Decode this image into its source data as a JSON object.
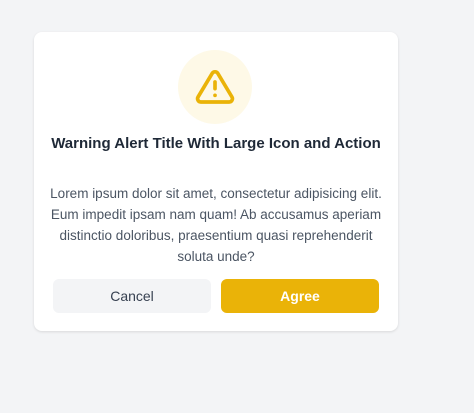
{
  "alert": {
    "icon": "warning-triangle-icon",
    "title": "Warning Alert Title With Large Icon and Action",
    "message": "Lorem ipsum dolor sit amet, consectetur adipisicing elit. Eum impedit ipsam nam quam! Ab accusamus aperiam distinctio doloribus, praesentium quasi reprehenderit soluta unde?",
    "cancel_label": "Cancel",
    "agree_label": "Agree"
  },
  "colors": {
    "accent": "#eab308",
    "icon_background": "#fef9e7",
    "page_background": "#f3f4f6",
    "card_background": "#ffffff",
    "cancel_background": "#f3f4f6"
  }
}
